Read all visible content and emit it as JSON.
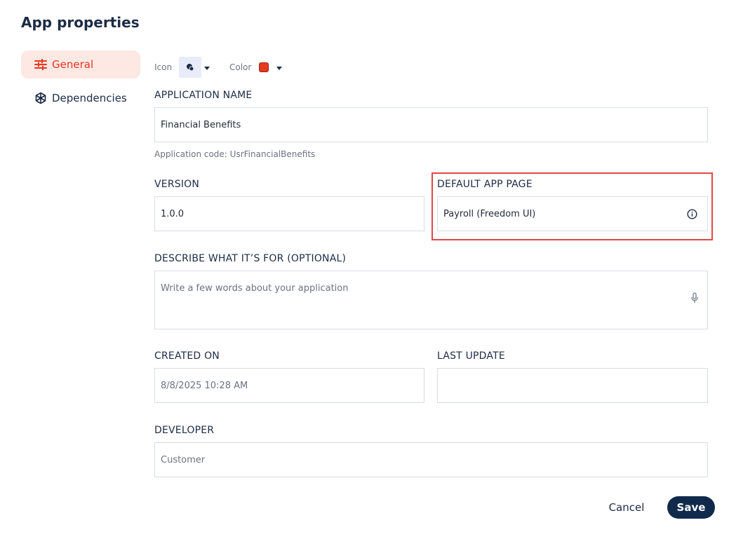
{
  "dialog": {
    "title": "App properties"
  },
  "nav": {
    "items": [
      {
        "label": "General",
        "icon": "sliders-icon",
        "active": true
      },
      {
        "label": "Dependencies",
        "icon": "network-icon",
        "active": false
      }
    ]
  },
  "appearance": {
    "icon_label": "Icon",
    "color_label": "Color",
    "color_value": "#e63c1e"
  },
  "form": {
    "application_name": {
      "label": "APPLICATION NAME",
      "value": "Financial Benefits"
    },
    "application_code": "Application code: UsrFinancialBenefits",
    "version": {
      "label": "VERSION",
      "value": "1.0.0"
    },
    "default_app_page": {
      "label": "DEFAULT APP PAGE",
      "value": "Payroll (Freedom UI)"
    },
    "description": {
      "label": "DESCRIBE WHAT IT’S FOR (OPTIONAL)",
      "placeholder": "Write a few words about your application"
    },
    "created_on": {
      "label": "CREATED ON",
      "value": "8/8/2025 10:28 AM"
    },
    "last_update": {
      "label": "LAST UPDATE",
      "value": ""
    },
    "developer": {
      "label": "DEVELOPER",
      "value": "Customer"
    }
  },
  "actions": {
    "cancel_label": "Cancel",
    "save_label": "Save"
  },
  "colors": {
    "accent": "#e8361c",
    "primary": "#102a4c",
    "highlight": "#e0474c"
  }
}
